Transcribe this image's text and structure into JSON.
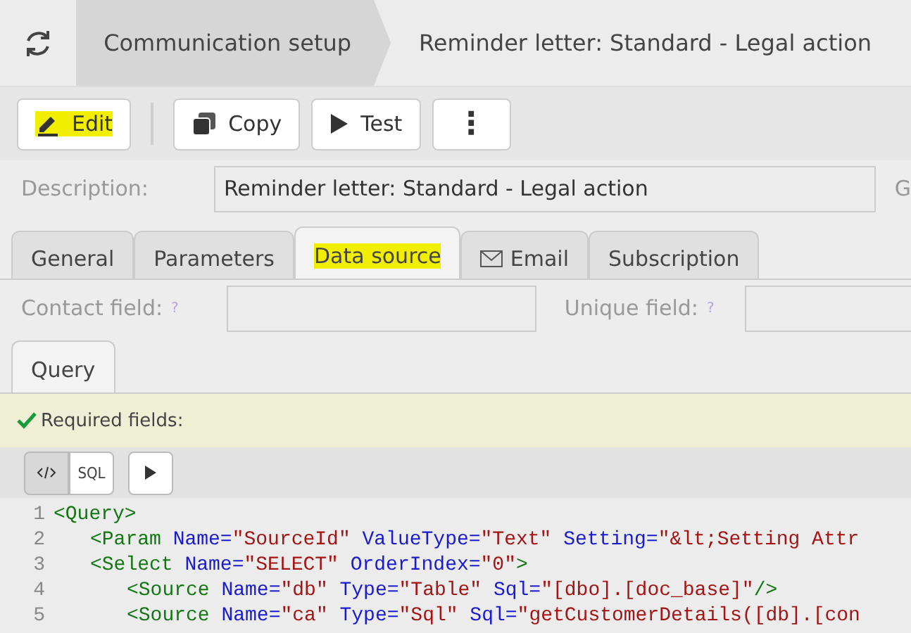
{
  "breadcrumbs": [
    {
      "label": "Communication setup",
      "selected": true
    },
    {
      "label": "Reminder letter: Standard - Legal action",
      "selected": false
    }
  ],
  "toolbar": [
    {
      "kind": "edit",
      "label": "Edit",
      "highlighted": true
    },
    {
      "kind": "copy",
      "label": "Copy",
      "highlighted": false
    },
    {
      "kind": "test",
      "label": "Test",
      "highlighted": false
    },
    {
      "kind": "more",
      "label": "⋮",
      "highlighted": false
    }
  ],
  "description": {
    "label": "Description:",
    "value": "Reminder letter: Standard - Legal action",
    "next_label": "G"
  },
  "tabs": [
    {
      "label": "General",
      "selected": false,
      "highlighted": false,
      "kind": "text"
    },
    {
      "label": "Parameters",
      "selected": false,
      "highlighted": false,
      "kind": "text"
    },
    {
      "label": "Data source",
      "selected": true,
      "highlighted": true,
      "kind": "text"
    },
    {
      "label": "Email",
      "selected": false,
      "highlighted": false,
      "kind": "mail"
    },
    {
      "label": "Subscription",
      "selected": false,
      "highlighted": false,
      "kind": "text"
    }
  ],
  "fields": [
    {
      "label": "Contact field:",
      "hint": "?"
    },
    {
      "label": "Unique field:",
      "hint": "?"
    }
  ],
  "subtabs": [
    {
      "label": "Query",
      "selected": true
    }
  ],
  "notice": {
    "text": "Required fields:",
    "ok": true
  },
  "editor_toolbar": [
    {
      "kind": "xml",
      "selected": true
    },
    {
      "kind": "sql",
      "label": "SQL",
      "selected": false
    },
    {
      "kind": "run",
      "selected": false
    }
  ],
  "code": [
    {
      "number": "1",
      "tokens": [
        {
          "kind": "tag",
          "text": "<Query>"
        }
      ],
      "children": [
        {
          "number": "2",
          "tokens": [
            {
              "kind": "tag",
              "text": "<Param"
            },
            {
              "kind": "attr",
              "text": " Name="
            },
            {
              "kind": "value",
              "text": "\"SourceId\""
            },
            {
              "kind": "attr",
              "text": " ValueType="
            },
            {
              "kind": "value",
              "text": "\"Text\""
            },
            {
              "kind": "attr",
              "text": " Setting="
            },
            {
              "kind": "value",
              "text": "\"&lt;Setting Attr"
            }
          ]
        },
        {
          "number": "3",
          "tokens": [
            {
              "kind": "tag",
              "text": "<Select"
            },
            {
              "kind": "attr",
              "text": " Name="
            },
            {
              "kind": "value",
              "text": "\"SELECT\""
            },
            {
              "kind": "attr",
              "text": " OrderIndex="
            },
            {
              "kind": "value",
              "text": "\"0\""
            },
            {
              "kind": "tag",
              "text": ">"
            }
          ],
          "children": [
            {
              "number": "4",
              "tokens": [
                {
                  "kind": "tag",
                  "text": "<Source"
                },
                {
                  "kind": "attr",
                  "text": " Name="
                },
                {
                  "kind": "value",
                  "text": "\"db\""
                },
                {
                  "kind": "attr",
                  "text": " Type="
                },
                {
                  "kind": "value",
                  "text": "\"Table\""
                },
                {
                  "kind": "attr",
                  "text": " Sql="
                },
                {
                  "kind": "value",
                  "text": "\"[dbo].[doc_base]\""
                },
                {
                  "kind": "tag",
                  "text": "/>"
                }
              ]
            },
            {
              "number": "5",
              "tokens": [
                {
                  "kind": "tag",
                  "text": "<Source"
                },
                {
                  "kind": "attr",
                  "text": " Name="
                },
                {
                  "kind": "value",
                  "text": "\"ca\""
                },
                {
                  "kind": "attr",
                  "text": " Type="
                },
                {
                  "kind": "value",
                  "text": "\"Sql\""
                },
                {
                  "kind": "attr",
                  "text": " Sql="
                },
                {
                  "kind": "value",
                  "text": "\"getCustomerDetails([db].[con"
                }
              ]
            }
          ]
        }
      ]
    }
  ]
}
